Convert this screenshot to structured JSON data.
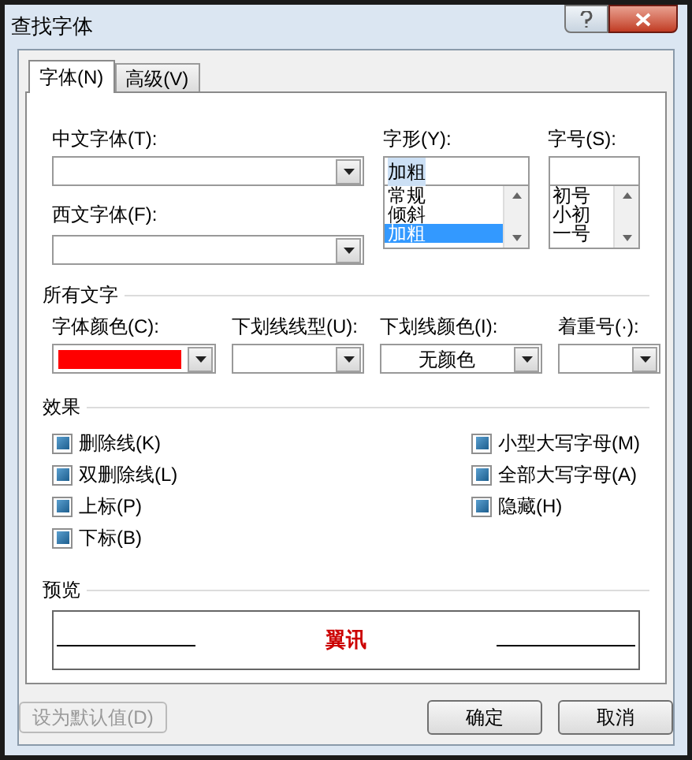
{
  "window": {
    "title": "查找字体"
  },
  "tabs": [
    {
      "label": "字体(N)",
      "selected": true
    },
    {
      "label": "高级(V)",
      "selected": false
    }
  ],
  "font_fields": {
    "chinese_label": "中文字体(T):",
    "western_label": "西文字体(F):"
  },
  "style": {
    "label": "字形(Y):",
    "value": "加粗",
    "options": [
      {
        "label": "常规",
        "selected": false
      },
      {
        "label": "倾斜",
        "selected": false
      },
      {
        "label": "加粗",
        "selected": true
      }
    ]
  },
  "size": {
    "label": "字号(S):",
    "options": [
      {
        "label": "初号",
        "selected": false
      },
      {
        "label": "小初",
        "selected": false
      },
      {
        "label": "一号",
        "selected": false
      }
    ]
  },
  "all_text": {
    "heading": "所有文字",
    "font_color_label": "字体颜色(C):",
    "font_color_swatch": {
      "color": "#ff0000"
    },
    "underline_style_label": "下划线线型(U):",
    "underline_color_label": "下划线颜色(I):",
    "underline_color_value": "无颜色",
    "emphasis_label": "着重号(·):"
  },
  "effects": {
    "heading": "效果",
    "left": [
      {
        "label": "删除线(K)",
        "mixed": true
      },
      {
        "label": "双删除线(L)",
        "mixed": true
      },
      {
        "label": "上标(P)",
        "mixed": true
      },
      {
        "label": "下标(B)",
        "mixed": true
      }
    ],
    "right": [
      {
        "label": "小型大写字母(M)",
        "mixed": true
      },
      {
        "label": "全部大写字母(A)",
        "mixed": true
      },
      {
        "label": "隐藏(H)",
        "mixed": true
      }
    ]
  },
  "preview": {
    "heading": "预览",
    "sample": "翼讯",
    "color": "#cc0000"
  },
  "buttons": [
    {
      "label": "设为默认值(D)",
      "disabled": true
    },
    {
      "label": "确定",
      "disabled": false
    },
    {
      "label": "取消",
      "disabled": false
    }
  ]
}
